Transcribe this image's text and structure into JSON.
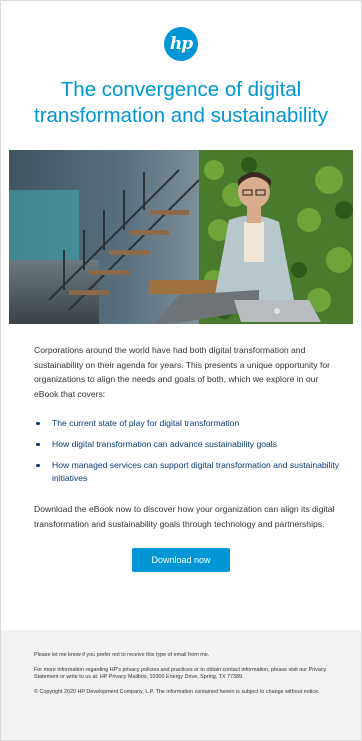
{
  "email": {
    "logo_text": "hp",
    "headline": "The convergence of digital transformation and sustainability",
    "intro": "Corporations around the world have had both digital transformation and sustainability on their agenda for years. This presents a unique opportunity for organizations to align the needs and goals of both, which we explore in our eBook that covers:",
    "bullets": [
      "The current state of play for digital transformation",
      "How digital transformation can advance sustainability goals",
      "How managed services can support digital transformation and sustainability initiatives"
    ],
    "cta_text": "Download the eBook now to discover how your organization can align its digital transformation and sustainability goals through technology and partnerships.",
    "button_label": "Download now",
    "accent_color": "#0096d6",
    "bullet_color": "#0b3b78"
  },
  "footer": {
    "optout": "Please let me know if you prefer not to receive this type of email from me.",
    "privacy": "For more information regarding HP's privacy policies and practices or to obtain contact information, please visit our Privacy Statement or write to us at: HP Privacy Mailbox, 10300 Energy Drive, Spring, TX 77389.",
    "copyright": "© Copyright 2020 HP Development Company, L.P. The information contained herein is subject to change without notice."
  }
}
